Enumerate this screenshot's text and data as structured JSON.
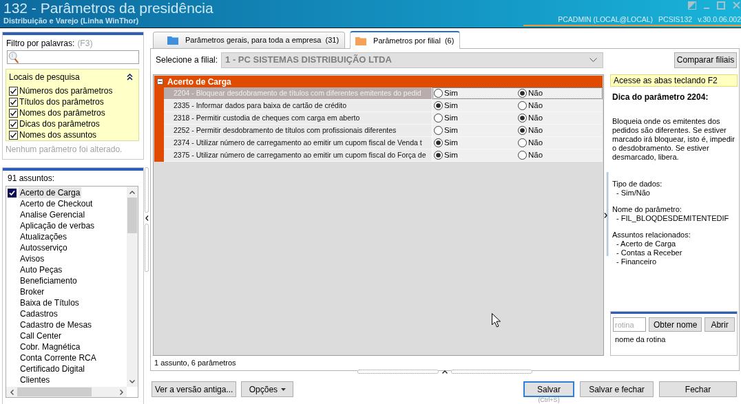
{
  "window": {
    "title": "132 - Parâmetros da presidência",
    "subtitle": "Distribuição e Varejo (Linha WinThor)",
    "user": "PCADMIN (LOCAL@LOCAL)",
    "routine": "PCSIS132",
    "version": "v.30.0.06.002"
  },
  "filter": {
    "label": "Filtro por palavras:",
    "shortcut": "(F3)",
    "search_locations": {
      "title": "Locais de pesquisa",
      "expanded": true,
      "options": [
        {
          "label": "Números dos parâmetros",
          "checked": true
        },
        {
          "label": "Títulos dos parâmetros",
          "checked": true
        },
        {
          "label": "Nomes dos parâmetros",
          "checked": true
        },
        {
          "label": "Dicas dos parâmetros",
          "checked": true
        },
        {
          "label": "Nomes dos assuntos",
          "checked": true
        }
      ]
    },
    "status": "Nenhum parâmetro foi alterado."
  },
  "subjects": {
    "count_label": "91 assuntos:",
    "items": [
      {
        "label": "Acerto de Carga",
        "checked": true,
        "selected": true
      },
      {
        "label": "Acerto de Checkout",
        "checked": false,
        "selected": false
      },
      {
        "label": "Analise Gerencial",
        "checked": false,
        "selected": false
      },
      {
        "label": "Aplicação de verbas",
        "checked": false,
        "selected": false
      },
      {
        "label": "Atualizações",
        "checked": false,
        "selected": false
      },
      {
        "label": "Autosserviço",
        "checked": false,
        "selected": false
      },
      {
        "label": "Avisos",
        "checked": false,
        "selected": false
      },
      {
        "label": "Auto Peças",
        "checked": false,
        "selected": false
      },
      {
        "label": "Beneficiamento",
        "checked": false,
        "selected": false
      },
      {
        "label": "Broker",
        "checked": false,
        "selected": false
      },
      {
        "label": "Baixa de Títulos",
        "checked": false,
        "selected": false
      },
      {
        "label": "Cadastros",
        "checked": false,
        "selected": false
      },
      {
        "label": "Cadastro de Mesas",
        "checked": false,
        "selected": false
      },
      {
        "label": "Call Center",
        "checked": false,
        "selected": false
      },
      {
        "label": "Cobr. Magnética",
        "checked": false,
        "selected": false
      },
      {
        "label": "Conta Corrente RCA",
        "checked": false,
        "selected": false
      },
      {
        "label": "Certificado Digital",
        "checked": false,
        "selected": false
      },
      {
        "label": "Clientes",
        "checked": false,
        "selected": false
      }
    ]
  },
  "tabs": [
    {
      "label": "Parâmetros gerais, para toda a empresa",
      "count": "(31)",
      "color": "#3d8fe0",
      "selected": false
    },
    {
      "label": "Parâmetros por filial",
      "count": "(6)",
      "color": "#f4a25a",
      "selected": true
    }
  ],
  "branch_select": {
    "label": "Selecione a filial:",
    "value": "1 - PC SISTEMAS DISTRIBUIÇÃO LTDA",
    "disabled": true
  },
  "compare_button": "Comparar filiais",
  "parameter_groups": [
    {
      "title": "Acerto de Carga",
      "expanded": true,
      "rows": [
        {
          "text": "2204 - Bloquear desdobramento de títulos com diferentes emitentes do pedid",
          "selected": true,
          "options": [
            {
              "label": "Sim",
              "selected": false
            },
            {
              "label": "Não",
              "selected": true
            }
          ]
        },
        {
          "text": "2335 - Informar dados para baixa de cartão de crédito",
          "selected": false,
          "options": [
            {
              "label": "Sim",
              "selected": true
            },
            {
              "label": "Não",
              "selected": false
            }
          ]
        },
        {
          "text": "2318 - Permitir custodia de cheques com carga em aberto",
          "selected": false,
          "options": [
            {
              "label": "Sim",
              "selected": false
            },
            {
              "label": "Não",
              "selected": true
            }
          ]
        },
        {
          "text": "2252 - Permitir desdobramento de títulos com profissionais diferentes",
          "selected": false,
          "options": [
            {
              "label": "Sim",
              "selected": false
            },
            {
              "label": "Não",
              "selected": true
            }
          ]
        },
        {
          "text": "2374 - Utilizar número de carregamento ao emitir um cupom fiscal de Venda t",
          "selected": false,
          "options": [
            {
              "label": "Sim",
              "selected": true
            },
            {
              "label": "Não",
              "selected": false
            }
          ]
        },
        {
          "text": "2375 - Utilizar número de carregamento ao emitir um cupom fiscal do Força de",
          "selected": false,
          "options": [
            {
              "label": "Sim",
              "selected": true
            },
            {
              "label": "Não",
              "selected": false
            }
          ]
        }
      ]
    }
  ],
  "summary": "1 assunto, 6 parâmetros",
  "help_panel": {
    "note": "Acesse as abas teclando F2",
    "title": "Dica do parâmetro 2204:",
    "description": "Bloqueia onde os emitentes dos pedidos são diferentes. Se estiver marcado irá bloquear, isto é, impedir o desdobramento. Se estiver desmarcado, libera.",
    "sections": [
      {
        "heading": "Tipo de dados:",
        "items": [
          "- Sim/Não"
        ]
      },
      {
        "heading": "Nome do parâmetro:",
        "items": [
          "- FIL_BLOQDESDEMITENTEDIF"
        ]
      },
      {
        "heading": "Assuntos relacionados:",
        "items": [
          "- Acerto de Carga",
          "- Contas a Receber",
          "- Financeiro"
        ]
      }
    ]
  },
  "routine_lookup": {
    "placeholder": "rotina",
    "lookup_button": "Obter nome",
    "open_button": "Abrir",
    "result": "nome da rotina"
  },
  "footer": {
    "left_buttons": [
      {
        "label": "Ver a versão antiga...",
        "kind": "plain"
      },
      {
        "label": "Opções",
        "kind": "menu"
      }
    ],
    "right_buttons": [
      {
        "label": "Salvar",
        "kind": "default",
        "hint": "(Ctrl+S)"
      },
      {
        "label": "Salvar e fechar",
        "kind": "plain"
      },
      {
        "label": "Fechar",
        "kind": "plain"
      }
    ]
  }
}
